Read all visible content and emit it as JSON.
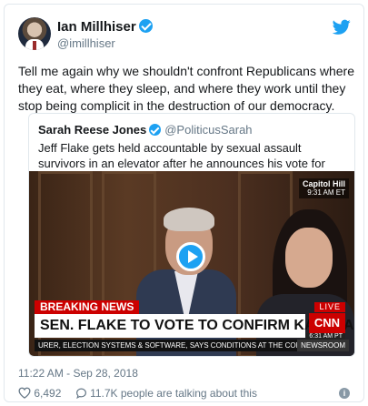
{
  "author": {
    "name": "Ian Millhiser",
    "handle": "@imillhiser",
    "verified": true
  },
  "tweet_text": "Tell me again why we shouldn't confront Republicans where they eat, where they sleep, and where they work until they stop being complicit in the destruction of our democracy.",
  "quoted_tweet": {
    "name": "Sarah Reese Jones",
    "handle": "@PoliticusSarah",
    "verified": true,
    "text": "Jeff Flake gets held accountable by sexual assault survivors in an elevator after he announces his vote for Kavanaugh.",
    "video": {
      "location": "Capitol Hill",
      "location_time": "9:31 AM ET",
      "breaking_label": "BREAKING NEWS",
      "headline": "SEN. FLAKE TO VOTE TO CONFIRM KAVANAUGH",
      "live_label": "LIVE",
      "network": "CNN",
      "network_time": "6:31 AM PT",
      "ticker": "URER, ELECTION SYSTEMS & SOFTWARE, SAYS CONDITIONS AT THE CONFE",
      "ticker_tag": "NEWSROOM",
      "play_icon": "play-icon"
    }
  },
  "timestamp": "11:22 AM - Sep 28, 2018",
  "likes": "6,492",
  "talking": "11.7K people are talking about this",
  "colors": {
    "twitter_blue": "#1da1f2",
    "cnn_red": "#cc0000",
    "muted": "#657786"
  }
}
